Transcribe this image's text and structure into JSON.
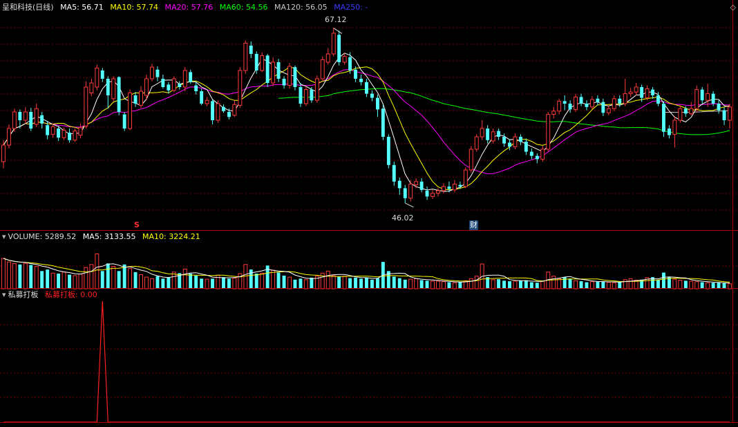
{
  "colors": {
    "up": "#ff3b3b",
    "down": "#54ffff",
    "ma5": "#ffffff",
    "ma10": "#ffff00",
    "ma20": "#ff00ff",
    "ma60": "#00ff00",
    "ma120": "#c8c8c8",
    "ma250": "#3c3cff",
    "grid": "#7a0000",
    "indicator": "#ff2020"
  },
  "header": {
    "stock_name": "呈和科技(日线)",
    "ma5": "MA5: 56.71",
    "ma10": "MA10: 57.74",
    "ma20": "MA20: 57.76",
    "ma60": "MA60: 54.56",
    "ma120": "MA120: 56.05",
    "ma250": "MA250: -"
  },
  "price_markers": {
    "high_label": "67.12",
    "low_label": "46.02",
    "flag_s": "S",
    "flag_cai": "财"
  },
  "volume_header": {
    "title": "VOLUME: 5289.52",
    "ma5": "MA5: 3133.55",
    "ma10": "MA10: 3224.21"
  },
  "indicator_header": {
    "title": "私募打板",
    "value": "私募打板: 0.00"
  },
  "chart_data": {
    "type": "candlestick",
    "price_range": [
      44,
      69
    ],
    "high": 67.12,
    "low": 46.02,
    "candles": [
      [
        51.0,
        53.0,
        50.2,
        53.6
      ],
      [
        53.0,
        55.0,
        52.6,
        55.5
      ],
      [
        55.0,
        57.0,
        54.6,
        57.4
      ],
      [
        57.0,
        56.0,
        55.0,
        57.3
      ],
      [
        56.0,
        57.0,
        55.6,
        57.6
      ],
      [
        57.0,
        55.0,
        54.7,
        57.5
      ],
      [
        55.5,
        57.4,
        55.2,
        58.0
      ],
      [
        56.6,
        55.6,
        55.0,
        57.0
      ],
      [
        55.4,
        54.2,
        53.7,
        55.9
      ],
      [
        54.3,
        55.2,
        53.9,
        55.6
      ],
      [
        55.0,
        53.9,
        53.5,
        55.3
      ],
      [
        53.9,
        54.8,
        53.6,
        55.1
      ],
      [
        54.5,
        53.6,
        53.3,
        55.0
      ],
      [
        53.6,
        54.7,
        53.4,
        55.0
      ],
      [
        54.2,
        55.1,
        53.8,
        55.6
      ],
      [
        55.3,
        60.0,
        55.0,
        60.7
      ],
      [
        59.3,
        60.5,
        58.9,
        61.0
      ],
      [
        60.0,
        62.3,
        59.6,
        62.7
      ],
      [
        62.0,
        61.0,
        60.6,
        62.3
      ],
      [
        61.0,
        59.0,
        57.4,
        61.3
      ],
      [
        58.6,
        61.0,
        58.3,
        61.3
      ],
      [
        61.2,
        57.0,
        56.6,
        61.3
      ],
      [
        56.7,
        55.0,
        54.7,
        57.0
      ],
      [
        55.0,
        59.3,
        54.8,
        59.7
      ],
      [
        59.0,
        58.0,
        57.6,
        59.4
      ],
      [
        57.8,
        59.5,
        57.5,
        60.1
      ],
      [
        59.0,
        61.0,
        58.4,
        61.5
      ],
      [
        61.0,
        62.4,
        60.7,
        62.8
      ],
      [
        62.1,
        61.2,
        60.7,
        62.5
      ],
      [
        61.0,
        60.0,
        59.8,
        61.5
      ],
      [
        60.3,
        59.6,
        59.2,
        60.6
      ],
      [
        59.6,
        61.0,
        59.4,
        61.3
      ],
      [
        60.4,
        60.0,
        59.7,
        60.7
      ],
      [
        60.0,
        62.0,
        59.5,
        62.4
      ],
      [
        61.8,
        60.6,
        60.4,
        62.1
      ],
      [
        60.2,
        59.5,
        59.1,
        60.6
      ],
      [
        59.5,
        58.0,
        57.8,
        59.8
      ],
      [
        58.0,
        58.4,
        57.7,
        58.8
      ],
      [
        58.3,
        56.0,
        55.5,
        58.5
      ],
      [
        56.0,
        58.0,
        55.7,
        58.4
      ],
      [
        57.6,
        57.1,
        56.9,
        57.9
      ],
      [
        57.0,
        56.4,
        56.1,
        57.4
      ],
      [
        56.6,
        57.9,
        56.4,
        58.4
      ],
      [
        57.8,
        62.0,
        57.5,
        62.4
      ],
      [
        62.0,
        65.3,
        61.6,
        65.6
      ],
      [
        65.0,
        64.0,
        63.5,
        65.5
      ],
      [
        64.0,
        62.0,
        61.6,
        64.3
      ],
      [
        62.0,
        63.8,
        61.8,
        64.2
      ],
      [
        63.8,
        60.5,
        60.0,
        64.0
      ],
      [
        60.5,
        63.0,
        60.1,
        63.6
      ],
      [
        63.0,
        61.0,
        60.6,
        63.4
      ],
      [
        61.0,
        60.2,
        59.8,
        61.3
      ],
      [
        60.2,
        62.5,
        59.8,
        62.9
      ],
      [
        62.4,
        60.0,
        59.6,
        62.6
      ],
      [
        60.0,
        58.0,
        57.6,
        60.5
      ],
      [
        58.0,
        59.7,
        57.7,
        60.1
      ],
      [
        59.7,
        58.4,
        58.1,
        60.0
      ],
      [
        58.4,
        61.0,
        58.1,
        61.4
      ],
      [
        61.0,
        63.3,
        60.8,
        63.7
      ],
      [
        63.0,
        64.0,
        62.7,
        64.7
      ],
      [
        64.0,
        66.5,
        63.7,
        67.12
      ],
      [
        66.3,
        63.0,
        62.6,
        66.8
      ],
      [
        63.0,
        63.7,
        62.7,
        64.1
      ],
      [
        63.6,
        62.0,
        61.6,
        64.2
      ],
      [
        62.1,
        61.0,
        60.6,
        62.5
      ],
      [
        61.0,
        60.6,
        60.2,
        61.5
      ],
      [
        60.6,
        59.2,
        58.8,
        61.0
      ],
      [
        59.2,
        58.7,
        58.3,
        59.6
      ],
      [
        58.7,
        57.3,
        56.4,
        59.1
      ],
      [
        57.4,
        54.0,
        53.6,
        57.9
      ],
      [
        54.0,
        50.6,
        50.2,
        54.3
      ],
      [
        50.6,
        48.6,
        48.1,
        51.0
      ],
      [
        48.7,
        47.8,
        47.0,
        49.1
      ],
      [
        47.8,
        46.6,
        46.02,
        48.2
      ],
      [
        46.6,
        48.3,
        46.2,
        48.8
      ],
      [
        48.2,
        48.6,
        47.8,
        49.0
      ],
      [
        48.6,
        47.6,
        47.3,
        49.0
      ],
      [
        47.5,
        46.8,
        46.4,
        48.0
      ],
      [
        46.8,
        47.2,
        46.5,
        47.6
      ],
      [
        47.2,
        47.5,
        46.8,
        47.8
      ],
      [
        47.5,
        48.0,
        47.2,
        48.4
      ],
      [
        48.0,
        47.7,
        47.3,
        48.6
      ],
      [
        47.6,
        48.3,
        47.3,
        48.8
      ],
      [
        48.2,
        48.0,
        47.7,
        48.6
      ],
      [
        48.0,
        50.0,
        47.8,
        50.3
      ],
      [
        50.0,
        52.5,
        49.7,
        52.9
      ],
      [
        52.5,
        54.0,
        52.2,
        54.3
      ],
      [
        54.0,
        55.0,
        53.6,
        56.0
      ],
      [
        55.0,
        53.6,
        53.2,
        55.4
      ],
      [
        53.5,
        54.6,
        53.2,
        55.0
      ],
      [
        54.7,
        54.0,
        53.6,
        55.0
      ],
      [
        54.0,
        53.2,
        52.8,
        54.4
      ],
      [
        53.3,
        52.8,
        52.4,
        53.7
      ],
      [
        52.8,
        54.0,
        52.5,
        54.4
      ],
      [
        54.0,
        53.4,
        53.0,
        54.3
      ],
      [
        53.4,
        52.2,
        51.8,
        53.8
      ],
      [
        52.2,
        51.7,
        51.3,
        52.6
      ],
      [
        51.7,
        51.3,
        50.8,
        52.0
      ],
      [
        51.3,
        52.5,
        51.0,
        52.9
      ],
      [
        52.5,
        56.7,
        52.2,
        57.0
      ],
      [
        56.7,
        57.1,
        56.2,
        57.6
      ],
      [
        57.1,
        58.3,
        56.7,
        58.6
      ],
      [
        58.3,
        58.0,
        57.2,
        59.0
      ],
      [
        58.0,
        57.3,
        56.9,
        58.4
      ],
      [
        57.3,
        58.8,
        57.0,
        59.2
      ],
      [
        58.8,
        58.0,
        57.7,
        59.2
      ],
      [
        58.0,
        57.6,
        57.2,
        58.4
      ],
      [
        57.6,
        58.5,
        57.3,
        58.9
      ],
      [
        58.6,
        58.2,
        57.8,
        59.0
      ],
      [
        58.2,
        56.9,
        56.5,
        58.6
      ],
      [
        56.9,
        57.4,
        56.6,
        57.8
      ],
      [
        57.4,
        58.6,
        57.1,
        59.0
      ],
      [
        58.6,
        58.0,
        57.6,
        59.0
      ],
      [
        58.0,
        59.2,
        57.7,
        61.0
      ],
      [
        59.2,
        59.4,
        58.8,
        59.9
      ],
      [
        59.4,
        60.0,
        59.0,
        60.5
      ],
      [
        60.0,
        58.7,
        58.2,
        60.3
      ],
      [
        58.7,
        59.8,
        58.4,
        60.2
      ],
      [
        59.7,
        59.0,
        58.6,
        60.0
      ],
      [
        59.0,
        58.0,
        57.7,
        59.4
      ],
      [
        58.0,
        54.6,
        54.0,
        58.3
      ],
      [
        55.0,
        54.2,
        53.8,
        55.4
      ],
      [
        54.3,
        56.0,
        52.7,
        56.5
      ],
      [
        56.0,
        57.4,
        55.7,
        57.8
      ],
      [
        57.4,
        56.8,
        56.4,
        57.7
      ],
      [
        56.8,
        57.4,
        56.6,
        58.2
      ],
      [
        57.4,
        59.7,
        57.0,
        60.2
      ],
      [
        59.7,
        58.4,
        58.0,
        60.0
      ],
      [
        58.4,
        59.2,
        57.6,
        60.4
      ],
      [
        59.2,
        58.0,
        57.7,
        59.5
      ],
      [
        58.0,
        57.2,
        56.8,
        58.4
      ],
      [
        57.2,
        56.0,
        55.4,
        57.6
      ],
      [
        56.0,
        57.6,
        55.0,
        58.0
      ]
    ],
    "volume_range": [
      0,
      9000
    ],
    "volume": [
      6000,
      5300,
      5000,
      4800,
      5000,
      4700,
      4400,
      3500,
      3800,
      3100,
      3000,
      3300,
      2800,
      2600,
      2900,
      4200,
      4800,
      6900,
      3500,
      5000,
      4400,
      3500,
      4800,
      4000,
      3300,
      2800,
      2300,
      2000,
      2500,
      2000,
      2300,
      3300,
      3100,
      3900,
      3000,
      2600,
      2000,
      1900,
      2000,
      2700,
      2300,
      2000,
      2100,
      3000,
      4800,
      3800,
      3000,
      3100,
      4600,
      3700,
      3200,
      2600,
      2300,
      1800,
      2000,
      1800,
      2200,
      2500,
      3100,
      3500,
      2600,
      2400,
      2500,
      2100,
      2200,
      2000,
      2200,
      1800,
      2100,
      5300,
      3500,
      2400,
      2100,
      1800,
      1900,
      2000,
      1700,
      1600,
      1500,
      1500,
      1400,
      1300,
      1200,
      1300,
      1600,
      2000,
      2500,
      4900,
      2300,
      1800,
      1900,
      1600,
      1500,
      1500,
      1600,
      1700,
      1300,
      1200,
      1500,
      3300,
      2500,
      2000,
      2300,
      2000,
      1600,
      1500,
      1300,
      1400,
      1400,
      1500,
      1300,
      1200,
      1300,
      1800,
      2000,
      1700,
      1800,
      2200,
      2300,
      1800,
      3200,
      2300,
      1900,
      1700,
      1600,
      1500,
      1400,
      1300,
      1200,
      1200,
      1200,
      1100,
      1000
    ],
    "indicator_range": [
      0,
      1
    ],
    "indicator_spike_index": 18,
    "indicator_value": 0.0
  }
}
